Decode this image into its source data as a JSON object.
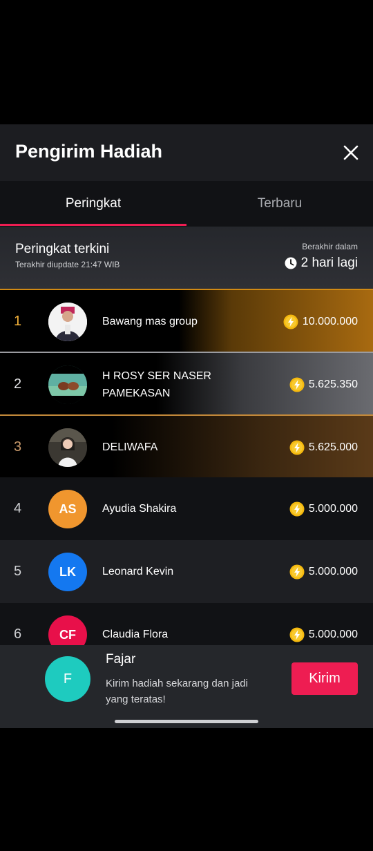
{
  "header": {
    "title": "Pengirim Hadiah",
    "close_icon": "close-icon"
  },
  "tabs": [
    {
      "label": "Peringkat",
      "active": true
    },
    {
      "label": "Terbaru",
      "active": false
    }
  ],
  "summary": {
    "title": "Peringkat terkini",
    "updated": "Terakhir diupdate 21:47 WIB",
    "ends_label": "Berakhir dalam",
    "ends_value": "2 hari lagi",
    "icon": "clock-icon"
  },
  "leaderboard": [
    {
      "rank": "1",
      "name": "Bawang mas group",
      "amount": "10.000.000",
      "avatar_initials": ""
    },
    {
      "rank": "2",
      "name": "H ROSY SER NASER PAMEKASAN",
      "amount": "5.625.350",
      "avatar_initials": ""
    },
    {
      "rank": "3",
      "name": "DELIWAFA",
      "amount": "5.625.000",
      "avatar_initials": ""
    },
    {
      "rank": "4",
      "name": "Ayudia Shakira",
      "amount": "5.000.000",
      "avatar_initials": "AS",
      "avatar_color": "#f0962e"
    },
    {
      "rank": "5",
      "name": "Leonard Kevin",
      "amount": "5.000.000",
      "avatar_initials": "LK",
      "avatar_color": "#1478f0"
    },
    {
      "rank": "6",
      "name": "Claudia Flora",
      "amount": "5.000.000",
      "avatar_initials": "CF",
      "avatar_color": "#e8104a"
    }
  ],
  "coin_icon": "coin-bolt-icon",
  "bottom": {
    "avatar_initial": "F",
    "name": "Fajar",
    "message": "Kirim hadiah sekarang dan jadi yang teratas!",
    "button_label": "Kirim"
  },
  "colors": {
    "accent": "#ee1d52",
    "gold": "#f3b23a",
    "coin": "#f5b90e"
  }
}
